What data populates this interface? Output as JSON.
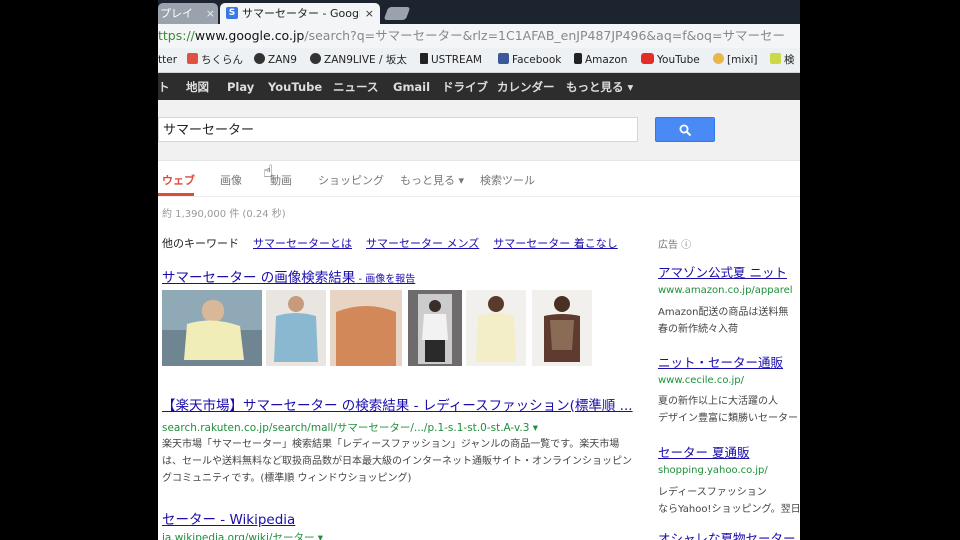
{
  "browser": {
    "tabs": [
      {
        "label": "プレイ",
        "close": "×"
      },
      {
        "label": "サマーセーター - Google",
        "close": "×",
        "favicon": "S"
      }
    ],
    "url": {
      "scheme": "ttps://",
      "host": "www.google.co.jp",
      "rest": "/search?q=サマーセーター&rlz=1C1AFAB_enJP487JP496&aq=f&oq=サマーセー"
    },
    "bookmarks": [
      {
        "label": "tter",
        "icon": "twitter-icon"
      },
      {
        "label": "ちくらん",
        "icon": "chikuran-icon"
      },
      {
        "label": "ZAN9",
        "icon": "zan9-icon"
      },
      {
        "label": "ZAN9LIVE / 坂太",
        "icon": "zan9live-icon"
      },
      {
        "label": "USTREAM",
        "icon": "ustream-icon"
      },
      {
        "label": "Facebook",
        "icon": "facebook-icon"
      },
      {
        "label": "Amazon",
        "icon": "amazon-icon"
      },
      {
        "label": "YouTube",
        "icon": "youtube-icon"
      },
      {
        "label": "[mixi]",
        "icon": "mixi-icon"
      },
      {
        "label": "検",
        "icon": "bookmark-icon"
      }
    ]
  },
  "gbar": [
    "ト",
    "地図",
    "Play",
    "YouTube",
    "ニュース",
    "Gmail",
    "ドライブ",
    "カレンダー",
    "もっと見る ▾"
  ],
  "search": {
    "query": "サマーセーター"
  },
  "search_tabs": [
    "ウェブ",
    "画像",
    "動画",
    "ショッピング",
    "もっと見る ▾",
    "検索ツール"
  ],
  "stats": "約 1,390,000 件 (0.24 秒)",
  "related": {
    "label": "他のキーワード",
    "links": [
      "サマーセーターとは",
      "サマーセーター メンズ",
      "サマーセーター 着こなし"
    ]
  },
  "image_result": {
    "title": "サマーセーター の画像検索結果",
    "report": " - 画像を報告"
  },
  "results": [
    {
      "title": "【楽天市場】サマーセーター の検索結果 - レディースファッション(標準順 ...",
      "url": "search.rakuten.co.jp/search/mall/サマーセーター/.../p.1-s.1-st.0-st.A-v.3 ▾",
      "snippet": "楽天市場「サマーセーター」検索結果「レディースファッション」ジャンルの商品一覧です。楽天市場は、セールや送料無料など取扱商品数が日本最大級のインターネット通販サイト・オンラインショッピングコミュニティです。(標準順 ウィンドウショッピング)"
    },
    {
      "title": "セーター - Wikipedia",
      "url": "ja.wikipedia.org/wiki/セーター ▾"
    }
  ],
  "ads": {
    "label": "広告 ⓘ",
    "items": [
      {
        "title": "アマゾン公式夏 ニット",
        "url": "www.amazon.co.jp/apparel",
        "lines": [
          "Amazon配送の商品は送料無",
          "春の新作続々入荷"
        ]
      },
      {
        "title": "ニット・セーター通販",
        "url": "www.cecile.co.jp/",
        "lines": [
          "夏の新作以上に大活躍の人",
          "デザイン豊富に類勝いセーター"
        ]
      },
      {
        "title": "セーター 夏通販",
        "url": "shopping.yahoo.co.jp/",
        "lines": [
          "レディースファッション",
          "ならYahoo!ショッピング。翌日"
        ]
      },
      {
        "title": "オシャレな夏物セーター",
        "url": "",
        "lines": []
      }
    ]
  },
  "colors": {
    "link": "#1a0dab",
    "url": "#1e8f3a",
    "accent": "#dd4b39",
    "search_button": "#4a8af4"
  }
}
